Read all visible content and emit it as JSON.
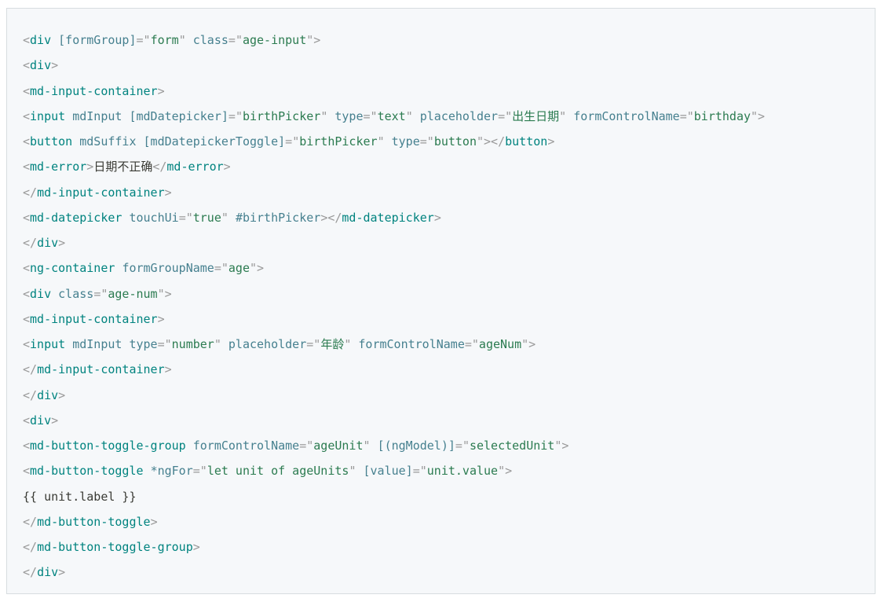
{
  "code": {
    "lines": [
      {
        "indent": 0,
        "segments": [
          {
            "c": "p",
            "t": "<"
          },
          {
            "c": "t",
            "t": "div"
          },
          {
            "c": "tx",
            "t": " "
          },
          {
            "c": "a",
            "t": "[formGroup]"
          },
          {
            "c": "p",
            "t": "="
          },
          {
            "c": "q",
            "t": "\""
          },
          {
            "c": "s",
            "t": "form"
          },
          {
            "c": "q",
            "t": "\""
          },
          {
            "c": "tx",
            "t": " "
          },
          {
            "c": "a",
            "t": "class"
          },
          {
            "c": "p",
            "t": "="
          },
          {
            "c": "q",
            "t": "\""
          },
          {
            "c": "s",
            "t": "age-input"
          },
          {
            "c": "q",
            "t": "\""
          },
          {
            "c": "p",
            "t": ">"
          }
        ]
      },
      {
        "indent": 1,
        "segments": [
          {
            "c": "p",
            "t": "<"
          },
          {
            "c": "t",
            "t": "div"
          },
          {
            "c": "p",
            "t": ">"
          }
        ]
      },
      {
        "indent": 2,
        "segments": [
          {
            "c": "p",
            "t": "<"
          },
          {
            "c": "t",
            "t": "md-input-container"
          },
          {
            "c": "p",
            "t": ">"
          }
        ]
      },
      {
        "indent": 3,
        "segments": [
          {
            "c": "p",
            "t": "<"
          },
          {
            "c": "t",
            "t": "input"
          },
          {
            "c": "tx",
            "t": " "
          },
          {
            "c": "a",
            "t": "mdInput"
          },
          {
            "c": "tx",
            "t": " "
          },
          {
            "c": "a",
            "t": "[mdDatepicker]"
          },
          {
            "c": "p",
            "t": "="
          },
          {
            "c": "q",
            "t": "\""
          },
          {
            "c": "s",
            "t": "birthPicker"
          },
          {
            "c": "q",
            "t": "\""
          },
          {
            "c": "tx",
            "t": " "
          },
          {
            "c": "a",
            "t": "type"
          },
          {
            "c": "p",
            "t": "="
          },
          {
            "c": "q",
            "t": "\""
          },
          {
            "c": "s",
            "t": "text"
          },
          {
            "c": "q",
            "t": "\""
          },
          {
            "c": "tx",
            "t": " "
          },
          {
            "c": "a",
            "t": "placeholder"
          },
          {
            "c": "p",
            "t": "="
          },
          {
            "c": "q",
            "t": "\""
          },
          {
            "c": "s",
            "t": "出生日期"
          },
          {
            "c": "q",
            "t": "\""
          },
          {
            "c": "tx",
            "t": " "
          },
          {
            "c": "a",
            "t": "formControlName"
          },
          {
            "c": "p",
            "t": "="
          },
          {
            "c": "q",
            "t": "\""
          },
          {
            "c": "s",
            "t": "birthday"
          },
          {
            "c": "q",
            "t": "\""
          },
          {
            "c": "p",
            "t": ">"
          }
        ]
      },
      {
        "indent": 3,
        "segments": [
          {
            "c": "p",
            "t": "<"
          },
          {
            "c": "t",
            "t": "button"
          },
          {
            "c": "tx",
            "t": " "
          },
          {
            "c": "a",
            "t": "mdSuffix"
          },
          {
            "c": "tx",
            "t": " "
          },
          {
            "c": "a",
            "t": "[mdDatepickerToggle]"
          },
          {
            "c": "p",
            "t": "="
          },
          {
            "c": "q",
            "t": "\""
          },
          {
            "c": "s",
            "t": "birthPicker"
          },
          {
            "c": "q",
            "t": "\""
          },
          {
            "c": "tx",
            "t": " "
          },
          {
            "c": "a",
            "t": "type"
          },
          {
            "c": "p",
            "t": "="
          },
          {
            "c": "q",
            "t": "\""
          },
          {
            "c": "s",
            "t": "button"
          },
          {
            "c": "q",
            "t": "\""
          },
          {
            "c": "p",
            "t": "></"
          },
          {
            "c": "t",
            "t": "button"
          },
          {
            "c": "p",
            "t": ">"
          }
        ]
      },
      {
        "indent": 3,
        "segments": [
          {
            "c": "p",
            "t": "<"
          },
          {
            "c": "t",
            "t": "md-error"
          },
          {
            "c": "p",
            "t": ">"
          },
          {
            "c": "tx",
            "t": "日期不正确"
          },
          {
            "c": "p",
            "t": "</"
          },
          {
            "c": "t",
            "t": "md-error"
          },
          {
            "c": "p",
            "t": ">"
          }
        ]
      },
      {
        "indent": 2,
        "segments": [
          {
            "c": "p",
            "t": "</"
          },
          {
            "c": "t",
            "t": "md-input-container"
          },
          {
            "c": "p",
            "t": ">"
          }
        ]
      },
      {
        "indent": 2,
        "segments": [
          {
            "c": "p",
            "t": "<"
          },
          {
            "c": "t",
            "t": "md-datepicker"
          },
          {
            "c": "tx",
            "t": " "
          },
          {
            "c": "a",
            "t": "touchUi"
          },
          {
            "c": "p",
            "t": "="
          },
          {
            "c": "q",
            "t": "\""
          },
          {
            "c": "s",
            "t": "true"
          },
          {
            "c": "q",
            "t": "\""
          },
          {
            "c": "tx",
            "t": " "
          },
          {
            "c": "a",
            "t": "#birthPicker"
          },
          {
            "c": "p",
            "t": "></"
          },
          {
            "c": "t",
            "t": "md-datepicker"
          },
          {
            "c": "p",
            "t": ">"
          }
        ]
      },
      {
        "indent": 1,
        "segments": [
          {
            "c": "p",
            "t": "</"
          },
          {
            "c": "t",
            "t": "div"
          },
          {
            "c": "p",
            "t": ">"
          }
        ]
      },
      {
        "indent": 1,
        "segments": [
          {
            "c": "p",
            "t": "<"
          },
          {
            "c": "t",
            "t": "ng-container"
          },
          {
            "c": "tx",
            "t": " "
          },
          {
            "c": "a",
            "t": "formGroupName"
          },
          {
            "c": "p",
            "t": "="
          },
          {
            "c": "q",
            "t": "\""
          },
          {
            "c": "s",
            "t": "age"
          },
          {
            "c": "q",
            "t": "\""
          },
          {
            "c": "p",
            "t": ">"
          }
        ]
      },
      {
        "indent": 2,
        "segments": [
          {
            "c": "p",
            "t": "<"
          },
          {
            "c": "t",
            "t": "div"
          },
          {
            "c": "tx",
            "t": " "
          },
          {
            "c": "a",
            "t": "class"
          },
          {
            "c": "p",
            "t": "="
          },
          {
            "c": "q",
            "t": "\""
          },
          {
            "c": "s",
            "t": "age-num"
          },
          {
            "c": "q",
            "t": "\""
          },
          {
            "c": "p",
            "t": ">"
          }
        ]
      },
      {
        "indent": 3,
        "segments": [
          {
            "c": "p",
            "t": "<"
          },
          {
            "c": "t",
            "t": "md-input-container"
          },
          {
            "c": "p",
            "t": ">"
          }
        ]
      },
      {
        "indent": 4,
        "segments": [
          {
            "c": "p",
            "t": "<"
          },
          {
            "c": "t",
            "t": "input"
          },
          {
            "c": "tx",
            "t": " "
          },
          {
            "c": "a",
            "t": "mdInput"
          },
          {
            "c": "tx",
            "t": " "
          },
          {
            "c": "a",
            "t": "type"
          },
          {
            "c": "p",
            "t": "="
          },
          {
            "c": "q",
            "t": "\""
          },
          {
            "c": "s",
            "t": "number"
          },
          {
            "c": "q",
            "t": "\""
          },
          {
            "c": "tx",
            "t": " "
          },
          {
            "c": "a",
            "t": "placeholder"
          },
          {
            "c": "p",
            "t": "="
          },
          {
            "c": "q",
            "t": "\""
          },
          {
            "c": "s",
            "t": "年龄"
          },
          {
            "c": "q",
            "t": "\""
          },
          {
            "c": "tx",
            "t": " "
          },
          {
            "c": "a",
            "t": "formControlName"
          },
          {
            "c": "p",
            "t": "="
          },
          {
            "c": "q",
            "t": "\""
          },
          {
            "c": "s",
            "t": "ageNum"
          },
          {
            "c": "q",
            "t": "\""
          },
          {
            "c": "p",
            "t": ">"
          }
        ]
      },
      {
        "indent": 3,
        "segments": [
          {
            "c": "p",
            "t": "</"
          },
          {
            "c": "t",
            "t": "md-input-container"
          },
          {
            "c": "p",
            "t": ">"
          }
        ]
      },
      {
        "indent": 2,
        "segments": [
          {
            "c": "p",
            "t": "</"
          },
          {
            "c": "t",
            "t": "div"
          },
          {
            "c": "p",
            "t": ">"
          }
        ]
      },
      {
        "indent": 2,
        "segments": [
          {
            "c": "p",
            "t": "<"
          },
          {
            "c": "t",
            "t": "div"
          },
          {
            "c": "p",
            "t": ">"
          }
        ]
      },
      {
        "indent": 3,
        "segments": [
          {
            "c": "p",
            "t": "<"
          },
          {
            "c": "t",
            "t": "md-button-toggle-group"
          },
          {
            "c": "tx",
            "t": " "
          },
          {
            "c": "a",
            "t": "formControlName"
          },
          {
            "c": "p",
            "t": "="
          },
          {
            "c": "q",
            "t": "\""
          },
          {
            "c": "s",
            "t": "ageUnit"
          },
          {
            "c": "q",
            "t": "\""
          },
          {
            "c": "tx",
            "t": " "
          },
          {
            "c": "a",
            "t": "[(ngModel)]"
          },
          {
            "c": "p",
            "t": "="
          },
          {
            "c": "q",
            "t": "\""
          },
          {
            "c": "s",
            "t": "selectedUnit"
          },
          {
            "c": "q",
            "t": "\""
          },
          {
            "c": "p",
            "t": ">"
          }
        ]
      },
      {
        "indent": 4,
        "segments": [
          {
            "c": "p",
            "t": "<"
          },
          {
            "c": "t",
            "t": "md-button-toggle"
          },
          {
            "c": "tx",
            "t": " "
          },
          {
            "c": "a",
            "t": "*ngFor"
          },
          {
            "c": "p",
            "t": "="
          },
          {
            "c": "q",
            "t": "\""
          },
          {
            "c": "s",
            "t": "let unit of ageUnits"
          },
          {
            "c": "q",
            "t": "\""
          },
          {
            "c": "tx",
            "t": " "
          },
          {
            "c": "a",
            "t": "[value]"
          },
          {
            "c": "p",
            "t": "="
          },
          {
            "c": "q",
            "t": "\""
          },
          {
            "c": "s",
            "t": "unit.value"
          },
          {
            "c": "q",
            "t": "\""
          },
          {
            "c": "p",
            "t": ">"
          }
        ]
      },
      {
        "indent": 5,
        "segments": [
          {
            "c": "tx",
            "t": "{{ unit.label }}"
          }
        ]
      },
      {
        "indent": 4,
        "segments": [
          {
            "c": "p",
            "t": "</"
          },
          {
            "c": "t",
            "t": "md-button-toggle"
          },
          {
            "c": "p",
            "t": ">"
          }
        ]
      },
      {
        "indent": 3,
        "segments": [
          {
            "c": "p",
            "t": "</"
          },
          {
            "c": "t",
            "t": "md-button-toggle-group"
          },
          {
            "c": "p",
            "t": ">"
          }
        ]
      },
      {
        "indent": 2,
        "segments": [
          {
            "c": "p",
            "t": "</"
          },
          {
            "c": "t",
            "t": "div"
          },
          {
            "c": "p",
            "t": ">"
          }
        ]
      }
    ]
  }
}
